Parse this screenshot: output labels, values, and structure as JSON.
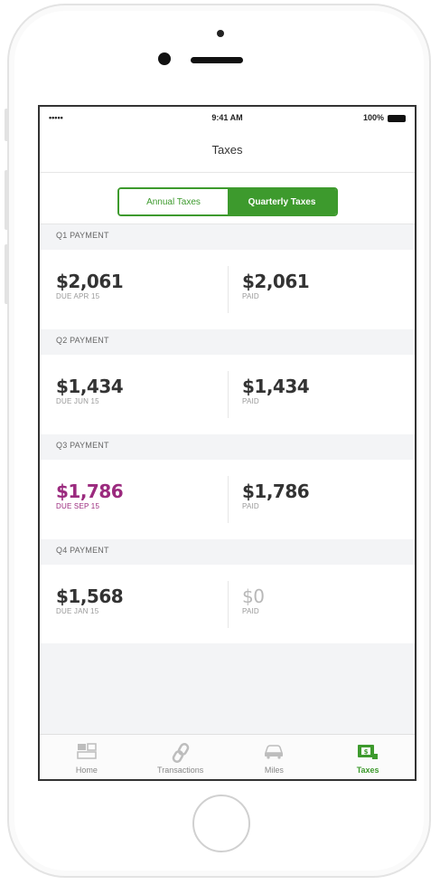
{
  "status_bar": {
    "signal": "•••••",
    "time": "9:41 AM",
    "battery": "100%"
  },
  "nav": {
    "title": "Taxes"
  },
  "segments": {
    "annual": "Annual Taxes",
    "quarterly": "Quarterly Taxes",
    "selected": "quarterly"
  },
  "payments": [
    {
      "header": "Q1 PAYMENT",
      "due_amount": "$2,061",
      "due_label": "DUE APR 15",
      "paid_amount": "$2,061",
      "paid_label": "PAID"
    },
    {
      "header": "Q2 PAYMENT",
      "due_amount": "$1,434",
      "due_label": "DUE JUN 15",
      "paid_amount": "$1,434",
      "paid_label": "PAID"
    },
    {
      "header": "Q3 PAYMENT",
      "due_amount": "$1,786",
      "due_label": "DUE SEP 15",
      "paid_amount": "$1,786",
      "paid_label": "PAID",
      "highlight": true
    },
    {
      "header": "Q4 PAYMENT",
      "due_amount": "$1,568",
      "due_label": "DUE JAN 15",
      "paid_amount": "$0",
      "paid_label": "PAID"
    }
  ],
  "tabs": [
    {
      "label": "Home",
      "icon": "home-icon"
    },
    {
      "label": "Transactions",
      "icon": "link-icon"
    },
    {
      "label": "Miles",
      "icon": "car-icon"
    },
    {
      "label": "Taxes",
      "icon": "taxes-icon",
      "active": true
    }
  ],
  "colors": {
    "accent": "#3d9a2d",
    "highlight": "#9b2a7e"
  }
}
